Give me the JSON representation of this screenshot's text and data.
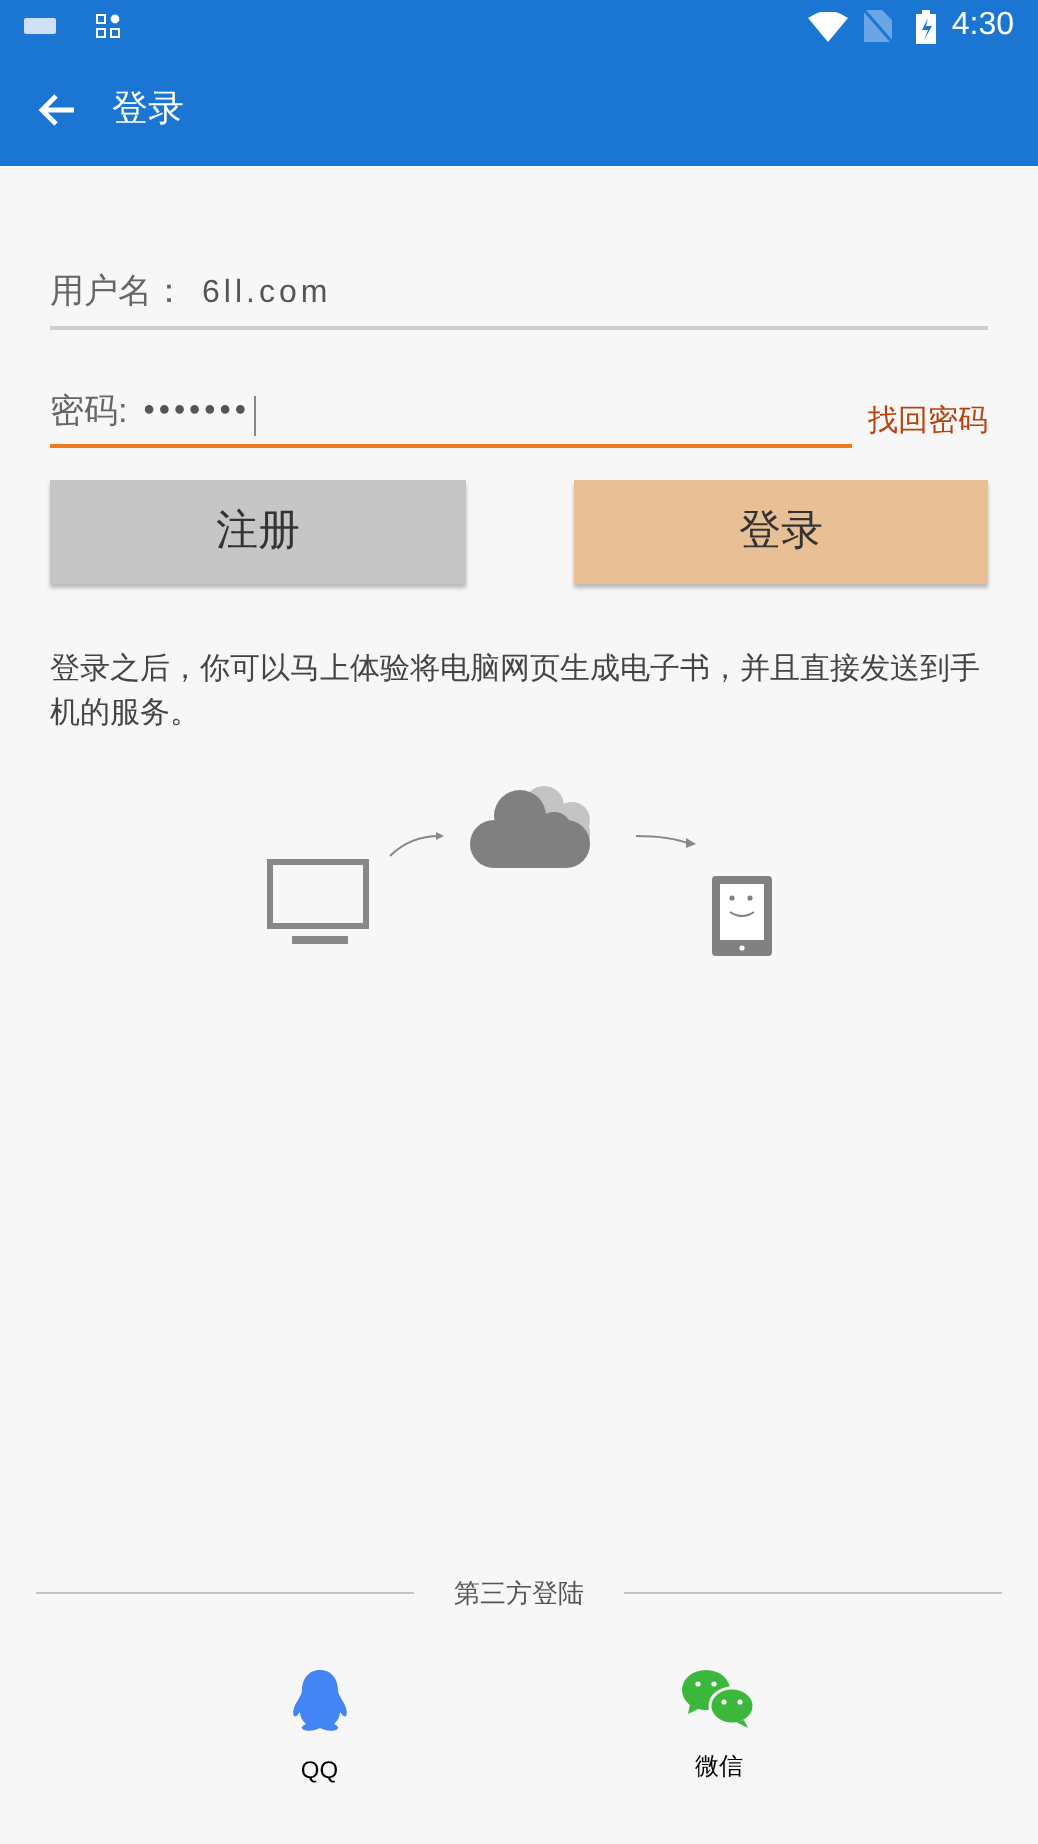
{
  "status_bar": {
    "time": "4:30"
  },
  "app_bar": {
    "title": "登录"
  },
  "username": {
    "label": "用户名：",
    "value": "6ll.com",
    "focused": false
  },
  "password": {
    "label": "密码:",
    "value": "•••••••",
    "focused": true
  },
  "forgot_link": "找回密码",
  "buttons": [
    {
      "label": "注册",
      "kind": "secondary"
    },
    {
      "label": "登录",
      "kind": "primary"
    }
  ],
  "description": "登录之后，你可以马上体验将电脑网页生成电子书，并且直接发送到手机的服务。",
  "third_party": {
    "heading": "第三方登陆",
    "options": [
      {
        "label": "QQ",
        "kind": "qq"
      },
      {
        "label": "微信",
        "kind": "wechat"
      }
    ]
  }
}
